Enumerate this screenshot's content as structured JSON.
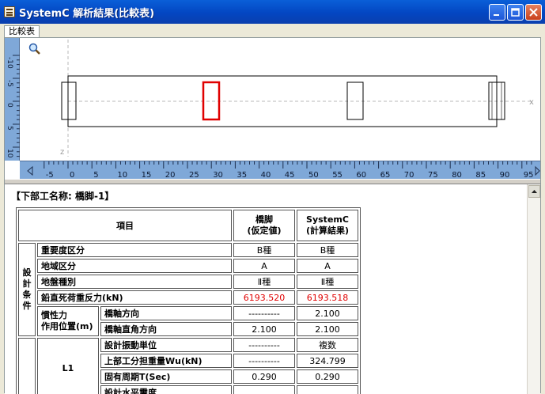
{
  "window": {
    "title": "SystemC 解析結果(比較表)"
  },
  "tabs": [
    {
      "label": "比較表"
    }
  ],
  "viewer": {
    "axis_x_label": "x",
    "axis_z_label": "z",
    "h_ticks": [
      "-5",
      "0",
      "5",
      "10",
      "15",
      "20",
      "25",
      "30",
      "35",
      "40",
      "45",
      "50",
      "55",
      "60",
      "65",
      "70",
      "75",
      "80",
      "85",
      "90",
      "95"
    ],
    "v_ticks": [
      "-10",
      "-5",
      "0",
      "5",
      "10"
    ]
  },
  "report": {
    "title": "【下部工名称: 橋脚-1】",
    "table": {
      "header_item": "項目",
      "header_col1": [
        "橋脚",
        "(仮定値)"
      ],
      "header_col2": [
        "SystemC",
        "(計算結果)"
      ],
      "group_design": "設計条件",
      "rows": [
        {
          "label": "重要度区分",
          "v1": "B種",
          "v2": "B種",
          "red": false
        },
        {
          "label": "地域区分",
          "v1": "A",
          "v2": "A",
          "red": false
        },
        {
          "label": "地盤種別",
          "v1": "Ⅱ種",
          "v2": "Ⅱ種",
          "red": false
        },
        {
          "label": "鉛直死荷重反力(kN)",
          "v1": "6193.520",
          "v2": "6193.518",
          "red": true
        }
      ],
      "inertia_label": [
        "慣性力",
        "作用位置(m)"
      ],
      "inertia_rows": [
        {
          "label": "橋軸方向",
          "v1": "----------",
          "v2": "2.100"
        },
        {
          "label": "橋軸直角方向",
          "v1": "2.100",
          "v2": "2.100"
        }
      ],
      "group_l1": "L1",
      "l1_rows": [
        {
          "label": "設計振動単位",
          "v1": "----------",
          "v2": "複数"
        },
        {
          "label": "上部工分担重量Wu(kN)",
          "v1": "----------",
          "v2": "324.799"
        },
        {
          "label": "固有周期T(Sec)",
          "v1": "0.290",
          "v2": "0.290"
        },
        {
          "label": "設計水平震度",
          "v1": "",
          "v2": ""
        }
      ]
    }
  },
  "colors": {
    "ruler": "#7fa8d8",
    "highlight": "#e00000",
    "title_bar": "#0a5fd8"
  }
}
